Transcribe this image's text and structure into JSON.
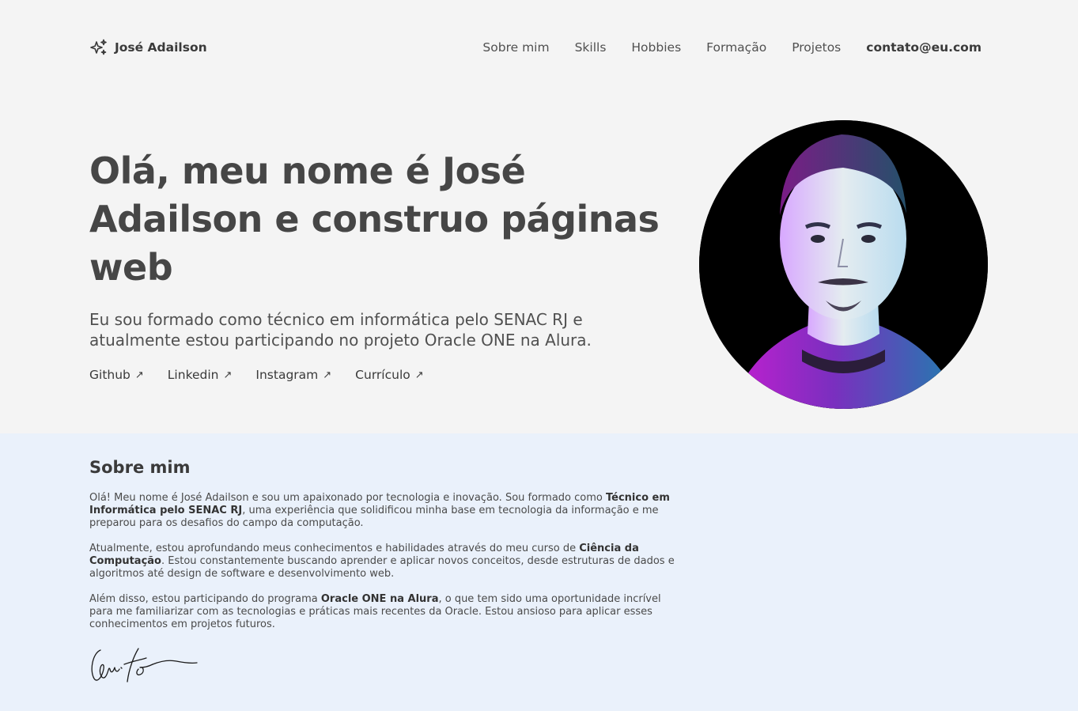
{
  "nav": {
    "brand": "José Adailson",
    "links": [
      "Sobre mim",
      "Skills",
      "Hobbies",
      "Formação",
      "Projetos"
    ],
    "email": "contato@eu.com"
  },
  "hero": {
    "headline": "Olá, meu nome é José Adailson e construo páginas web",
    "subtitle": "Eu sou formado como técnico em informática pelo SENAC RJ e atualmente estou participando no projeto Oracle ONE na Alura.",
    "social": [
      {
        "label": "Github",
        "arrow": "↗"
      },
      {
        "label": "Linkedin",
        "arrow": "↗"
      },
      {
        "label": "Instagram",
        "arrow": "↗"
      },
      {
        "label": "Currículo",
        "arrow": "↗"
      }
    ]
  },
  "about": {
    "title": "Sobre mim",
    "p1": {
      "a": "Olá! Meu nome é José Adailson e sou um apaixonado por tecnologia e inovação. Sou formado como ",
      "b": "Técnico em Informática pelo SENAC RJ",
      "c": ", uma experiência que solidificou minha base em tecnologia da informação e me preparou para os desafios do campo da computação."
    },
    "p2": {
      "a": "Atualmente, estou aprofundando meus conhecimentos e habilidades através do meu curso de ",
      "b": "Ciência da Computação",
      "c": ". Estou constantemente buscando aprender e aplicar novos conceitos, desde estruturas de dados e algoritmos até design de software e desenvolvimento web."
    },
    "p3": {
      "a": "Além disso, estou participando do programa ",
      "b": "Oracle ONE na Alura",
      "c": ", o que tem sido uma oportunidade incrível para me familiarizar com as tecnologias e práticas mais recentes da Oracle. Estou ansioso para aplicar esses conhecimentos em projetos futuros."
    }
  },
  "colors": {
    "page_bg": "#f4f4f4",
    "about_bg": "#eaf1fb",
    "text": "#464646"
  }
}
